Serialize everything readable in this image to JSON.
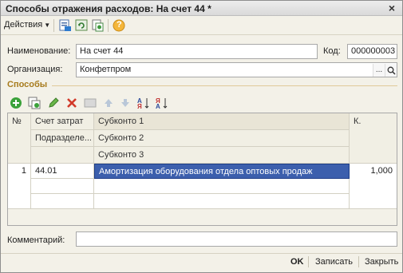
{
  "window": {
    "title": "Способы отражения расходов: На счет 44 *",
    "close_glyph": "×"
  },
  "toolbar": {
    "actions_label": "Действия",
    "icons": [
      "save-list-icon",
      "refresh-icon",
      "copy-doc-icon",
      "help-icon"
    ],
    "help_glyph": "?"
  },
  "form": {
    "name_label": "Наименование:",
    "name_value": "На счет 44",
    "code_label": "Код:",
    "code_value": "000000003",
    "org_label": "Организация:",
    "org_value": "Конфетпром",
    "org_select_glyph": "...",
    "comment_label": "Комментарий:",
    "comment_value": ""
  },
  "section": {
    "title": "Способы"
  },
  "table": {
    "headers": {
      "num": "№",
      "account": "Счет затрат",
      "subdivision": "Подразделе...",
      "subconto1": "Субконто 1",
      "subconto2": "Субконто 2",
      "subconto3": "Субконто 3",
      "coef": "К."
    },
    "rows": [
      {
        "num": "1",
        "account": "44.01",
        "subconto1": "Амортизация оборудования отдела оптовых продаж",
        "coef": "1,000"
      }
    ]
  },
  "footer": {
    "ok_label": "OK",
    "save_label": "Записать",
    "close_label": "Закрыть"
  },
  "colors": {
    "accent_section": "#a77b1d",
    "selection": "#3c5fad"
  }
}
